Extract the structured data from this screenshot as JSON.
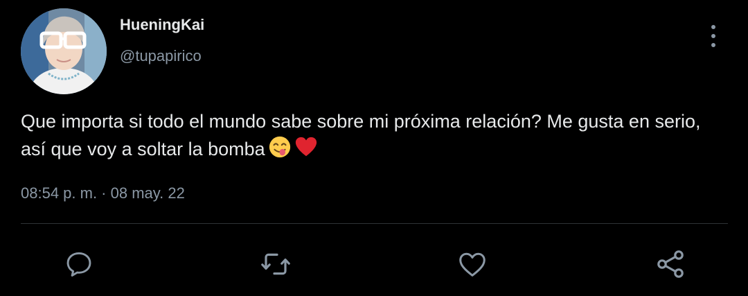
{
  "author": {
    "display_name": "HueningKai",
    "handle": "@tupapirico",
    "avatar_icon": "profile-photo"
  },
  "tweet": {
    "text": "Que importa si todo el mundo sabe sobre mi próxima relación? Me gusta en serio, así que voy a soltar la bomba",
    "emojis": [
      "face-savoring-food-emoji",
      "red-heart-emoji"
    ],
    "timestamp": "08:54 p. m. · 08 may. 22"
  },
  "actions": {
    "reply_icon": "reply-icon",
    "retweet_icon": "retweet-icon",
    "like_icon": "heart-icon",
    "share_icon": "share-icon",
    "more_icon": "more-vertical-icon"
  },
  "colors": {
    "background": "#000000",
    "primary_text": "#e7e9ea",
    "secondary_text": "#8b98a5",
    "divider": "#2f3336",
    "heart_emoji": "#e0242f"
  }
}
